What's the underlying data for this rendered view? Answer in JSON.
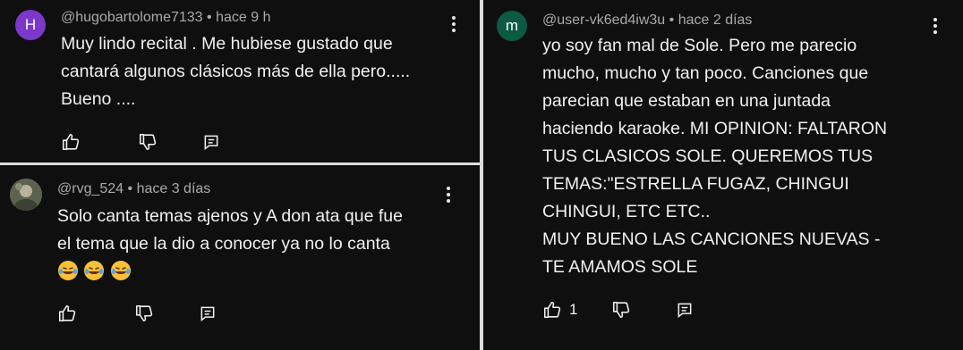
{
  "comments": [
    {
      "avatar_letter": "H",
      "avatar_color": "#7b38c9",
      "handle": "@hugobartolome7133",
      "time": "• hace 9 h",
      "text": "Muy lindo recital . Me hubiese gustado que\ncantará algunos clásicos más de ella pero.....\nBueno ....",
      "likes": ""
    },
    {
      "avatar_letter": "",
      "avatar_color": "#6b6f5a",
      "handle": "@rvg_524",
      "time": "• hace 3 días",
      "text": "Solo canta temas ajenos y A don ata que fue\nel tema que la dio a conocer ya no lo canta",
      "emojis": [
        "😂",
        "😂",
        "😂"
      ],
      "likes": ""
    },
    {
      "avatar_letter": "m",
      "avatar_color": "#0d5a43",
      "handle": "@user-vk6ed4iw3u",
      "time": "• hace 2 días",
      "text": "yo soy fan mal de Sole. Pero me parecio\nmucho, mucho y tan poco. Canciones que\nparecian que estaban en una juntada\nhaciendo karaoke. MI OPINION: FALTARON\nTUS CLASICOS SOLE. QUEREMOS TUS\nTEMAS:\"ESTRELLA FUGAZ, CHINGUI\nCHINGUI, ETC ETC..\nMUY BUENO LAS CANCIONES NUEVAS -\nTE AMAMOS SOLE",
      "likes": "1"
    }
  ],
  "icons": {
    "like": "thumbs-up-icon",
    "dislike": "thumbs-down-icon",
    "reply": "reply-icon",
    "more": "more-vertical-icon"
  }
}
